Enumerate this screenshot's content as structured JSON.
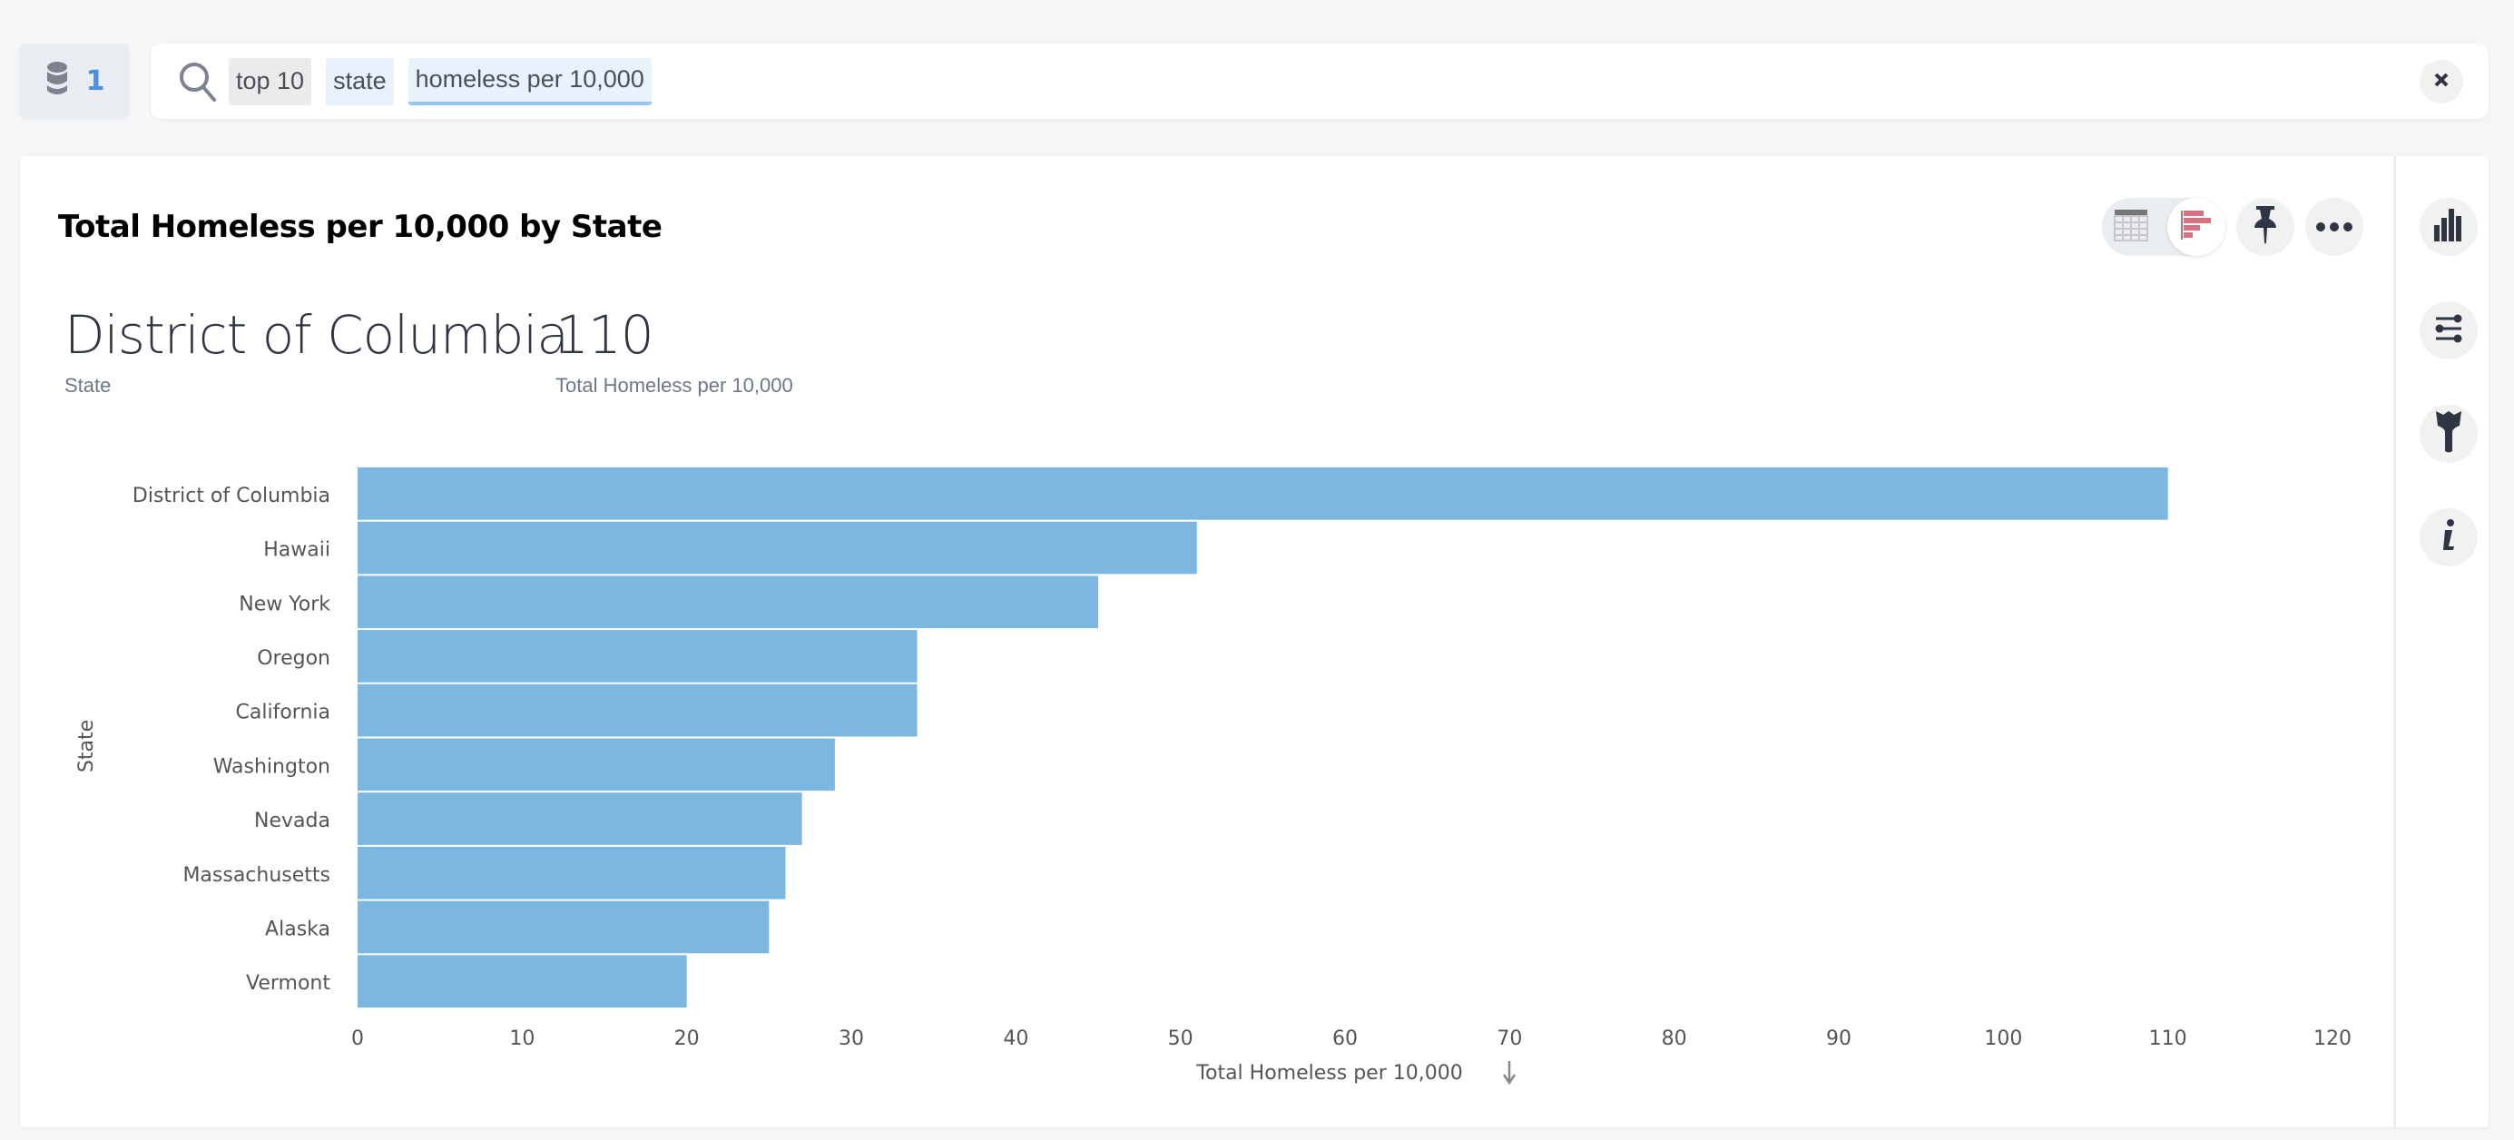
{
  "datasource": {
    "icon": "database-icon",
    "count": "1"
  },
  "search": {
    "tokens": [
      {
        "text": "top 10",
        "type": "keyword"
      },
      {
        "text": "state",
        "type": "attribute"
      },
      {
        "text": "homeless per 10,000",
        "type": "measure"
      }
    ],
    "clear_icon": "close-icon"
  },
  "card": {
    "title": "Total Homeless per 10,000 by State",
    "toolbar": {
      "view_options": [
        "table-view",
        "chart-view"
      ],
      "active_view": "chart-view",
      "pin_icon": "pin-icon",
      "more_icon": "more-icon"
    },
    "headline": {
      "primary_value": "District of Columbia",
      "primary_label": "State",
      "secondary_value": "110",
      "secondary_label": "Total Homeless per 10,000"
    },
    "side_panel": [
      "chart-type-icon",
      "configure-icon",
      "format-brush-icon",
      "info-icon"
    ]
  },
  "colors": {
    "bar": "#7db6df",
    "accent": "#4a90e2",
    "chart_toggle": "#d97282",
    "icon_dark": "#2f3542"
  },
  "chart_data": {
    "type": "bar",
    "orientation": "horizontal",
    "title": "Total Homeless per 10,000 by State",
    "categories": [
      "District of Columbia",
      "Hawaii",
      "New York",
      "Oregon",
      "California",
      "Washington",
      "Nevada",
      "Massachusetts",
      "Alaska",
      "Vermont"
    ],
    "values": [
      110,
      51,
      45,
      34,
      34,
      29,
      27,
      26,
      25,
      20
    ],
    "xlabel": "Total Homeless per 10,000",
    "ylabel": "State",
    "xlim": [
      0,
      120
    ],
    "xticks": [
      0,
      10,
      20,
      30,
      40,
      50,
      60,
      70,
      80,
      90,
      100,
      110,
      120
    ],
    "sort": "descending",
    "grid": false,
    "legend": "none"
  }
}
